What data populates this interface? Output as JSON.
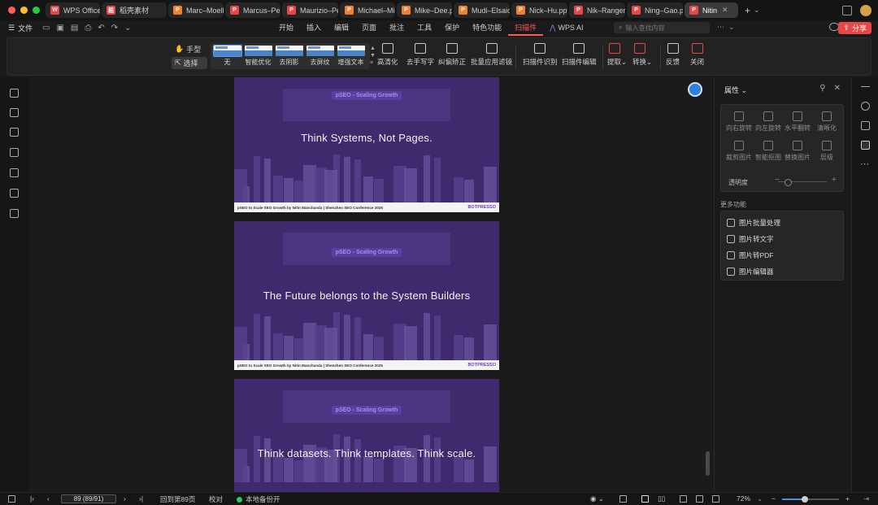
{
  "titlebar": {
    "tabs": [
      {
        "label": "WPS Office",
        "color": "#e64848",
        "glyph": "W"
      },
      {
        "label": "稻壳素材",
        "color": "#e64848",
        "glyph": "稻"
      },
      {
        "label": "Marc–Moell",
        "color": "#f07f2f",
        "glyph": "P"
      },
      {
        "label": "Marcus–Per",
        "color": "#e64848",
        "glyph": "P"
      },
      {
        "label": "Maurizio–Pe",
        "color": "#e64848",
        "glyph": "P"
      },
      {
        "label": "Michael–Mi",
        "color": "#f07f2f",
        "glyph": "P"
      },
      {
        "label": "Mike–Dee.p",
        "color": "#f07f2f",
        "glyph": "P"
      },
      {
        "label": "Mudi–Elsaid",
        "color": "#f07f2f",
        "glyph": "P"
      },
      {
        "label": "Nick–Hu.ppt",
        "color": "#f07f2f",
        "glyph": "P"
      },
      {
        "label": "Nik–Ranger",
        "color": "#e64848",
        "glyph": "P"
      },
      {
        "label": "Ning–Gao.p",
        "color": "#e64848",
        "glyph": "P"
      },
      {
        "label": "Nitin",
        "color": "#e64848",
        "glyph": "P"
      }
    ],
    "add_tab": "+",
    "add_tab_arrow": "⌄"
  },
  "menubar": {
    "file": "文件",
    "menus": [
      "开始",
      "插入",
      "编辑",
      "页面",
      "批注",
      "工具",
      "保护",
      "特色功能",
      "扫描件",
      "WPS AI"
    ],
    "active_menu": "扫描件",
    "search_placeholder": "输入查找内容",
    "share": "分享"
  },
  "ribbon": {
    "hand": "手型",
    "select": "选择",
    "filters": [
      "无",
      "智能优化",
      "去阴影",
      "去屏纹",
      "增强文本"
    ],
    "thumb_label": "WPS Office",
    "tools": [
      {
        "label": "高清化",
        "name": "hd-button"
      },
      {
        "label": "去手写字",
        "name": "remove-handwriting-button"
      },
      {
        "label": "纠偏矫正",
        "name": "deskew-button"
      },
      {
        "label": "批量应用滤镜",
        "name": "batch-filter-button"
      },
      {
        "label": "扫描件识别",
        "name": "scan-recognize-button"
      },
      {
        "label": "扫描件编辑",
        "name": "scan-edit-button"
      },
      {
        "label": "提取",
        "name": "extract-button",
        "dropdown": true
      },
      {
        "label": "转换",
        "name": "convert-button",
        "dropdown": true
      },
      {
        "label": "反馈",
        "name": "feedback-button"
      },
      {
        "label": "关闭",
        "name": "close-ribbon-button"
      }
    ]
  },
  "slides": [
    {
      "tag": "pSEO - Scaling Growth",
      "text": "Think Systems, Not Pages.",
      "footer": "pSEO to Scale SEO Growth by Nitin Manchanda | Shenzhen SEO Conference 2025",
      "brand": "BOTPRESSO"
    },
    {
      "tag": "pSEO - Scaling Growth",
      "text": "The Future belongs to the System Builders",
      "footer": "pSEO to Scale SEO Growth by Nitin Manchanda | Shenzhen SEO Conference 2025",
      "brand": "BOTPRESSO"
    },
    {
      "tag": "pSEO - Scaling Growth",
      "text": "Think datasets. Think templates. Think scale.",
      "footer": "",
      "brand": ""
    }
  ],
  "properties": {
    "title": "属性",
    "items": [
      "向右旋转",
      "向左旋转",
      "水平翻转",
      "清晰化",
      "裁剪图片",
      "智能抠图",
      "替换图片",
      "层级"
    ],
    "opacity_label": "透明度",
    "more_title": "更多功能",
    "more_items": [
      "图片批量处理",
      "图片转文字",
      "图片转PDF",
      "图片编辑器"
    ]
  },
  "statusbar": {
    "page_input": "89 (89/91)",
    "goto": "回到第89页",
    "proofread": "校对",
    "backup": "本地备份开",
    "zoom": "72%",
    "zoom_fraction": 0.4
  },
  "colors": {
    "accent_red": "#e64848",
    "slide_purple": "#3f2a6e",
    "zoom_blue": "#4a90e2"
  }
}
